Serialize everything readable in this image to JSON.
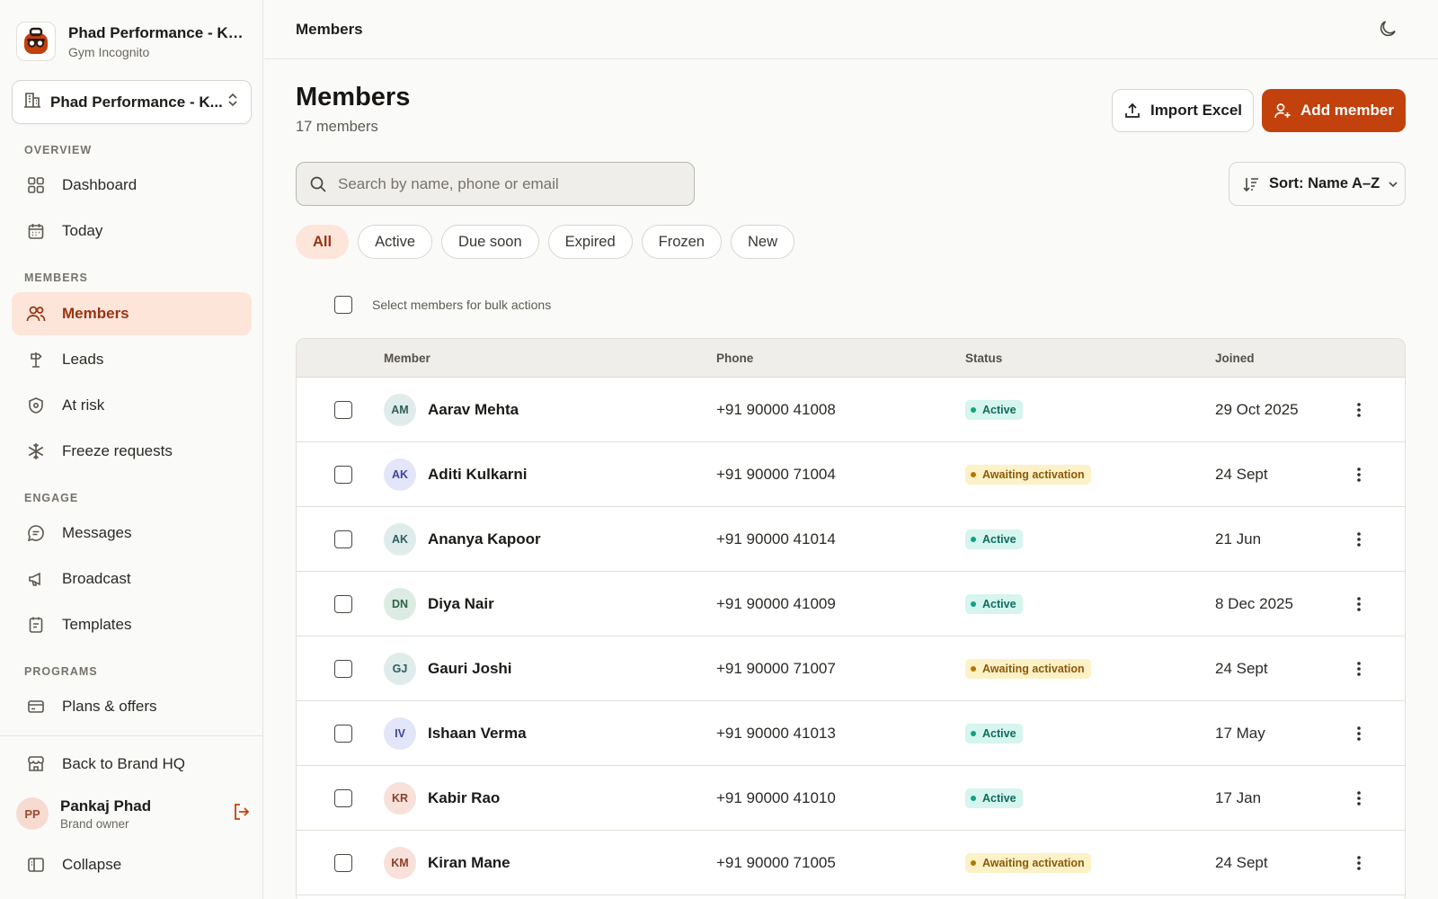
{
  "brand": {
    "name": "Phad Performance - Kot...",
    "subtitle": "Gym Incognito"
  },
  "location_select": {
    "label": "Phad Performance - K..."
  },
  "nav": {
    "sections": {
      "overview": "OVERVIEW",
      "members": "MEMBERS",
      "engage": "ENGAGE",
      "programs": "PROGRAMS"
    },
    "items": {
      "dashboard": "Dashboard",
      "today": "Today",
      "members": "Members",
      "leads": "Leads",
      "at_risk": "At risk",
      "freeze": "Freeze requests",
      "messages": "Messages",
      "broadcast": "Broadcast",
      "templates": "Templates",
      "plans": "Plans & offers",
      "back_hq": "Back to Brand HQ",
      "collapse": "Collapse"
    },
    "active": "members"
  },
  "user": {
    "initials": "PP",
    "name": "Pankaj Phad",
    "role": "Brand owner"
  },
  "topbar": {
    "title": "Members"
  },
  "page": {
    "title": "Members",
    "subtitle": "17 members"
  },
  "actions": {
    "import": "Import Excel",
    "add": "Add member"
  },
  "search": {
    "placeholder": "Search by name, phone or email",
    "value": ""
  },
  "sort": {
    "label": "Sort: Name A–Z"
  },
  "filters": [
    "All",
    "Active",
    "Due soon",
    "Expired",
    "Frozen",
    "New"
  ],
  "active_filter": "All",
  "bulk": {
    "label": "Select members for bulk actions",
    "checked": false
  },
  "table": {
    "columns": {
      "member": "Member",
      "phone": "Phone",
      "status": "Status",
      "joined": "Joined"
    },
    "rows": [
      {
        "initials": "AM",
        "name": "Aarav Mehta",
        "phone": "+91 90000 41008",
        "status": "Active",
        "joined": "29 Oct 2025"
      },
      {
        "initials": "AK",
        "name": "Aditi Kulkarni",
        "phone": "+91 90000 71004",
        "status": "Awaiting activation",
        "joined": "24 Sept"
      },
      {
        "initials": "AK",
        "name": "Ananya Kapoor",
        "phone": "+91 90000 41014",
        "status": "Active",
        "joined": "21 Jun"
      },
      {
        "initials": "DN",
        "name": "Diya Nair",
        "phone": "+91 90000 41009",
        "status": "Active",
        "joined": "8 Dec 2025"
      },
      {
        "initials": "GJ",
        "name": "Gauri Joshi",
        "phone": "+91 90000 71007",
        "status": "Awaiting activation",
        "joined": "24 Sept"
      },
      {
        "initials": "IV",
        "name": "Ishaan Verma",
        "phone": "+91 90000 41013",
        "status": "Active",
        "joined": "17 May"
      },
      {
        "initials": "KR",
        "name": "Kabir Rao",
        "phone": "+91 90000 41010",
        "status": "Active",
        "joined": "17 Jan"
      },
      {
        "initials": "KM",
        "name": "Kiran Mane",
        "phone": "+91 90000 71005",
        "status": "Awaiting activation",
        "joined": "24 Sept"
      }
    ]
  },
  "colors": {
    "accent": "#c2410c",
    "active_nav_bg": "#fde5da",
    "status_active_bg": "#d5f5ee",
    "status_active_fg": "#0f6b5c",
    "status_awaiting_bg": "#fdf1c7",
    "status_awaiting_fg": "#8a5a0a"
  }
}
